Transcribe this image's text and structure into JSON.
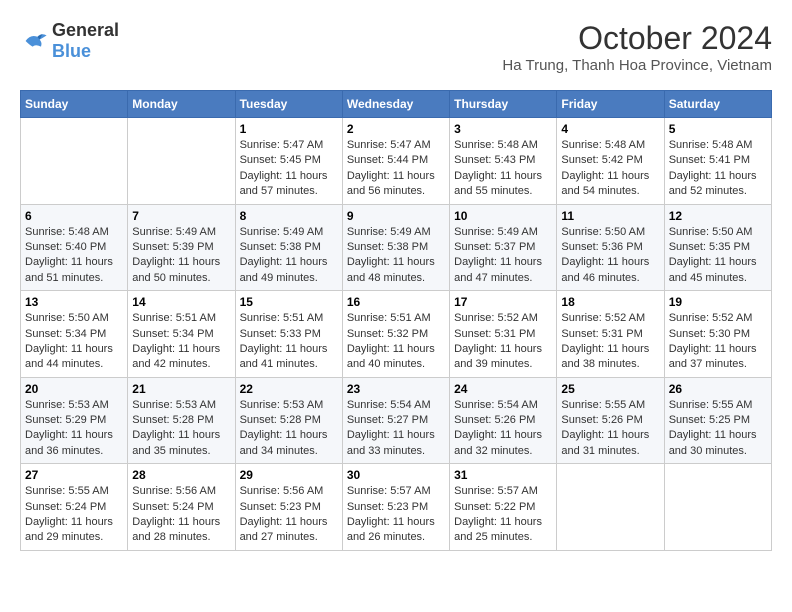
{
  "logo": {
    "line1": "General",
    "line2": "Blue"
  },
  "title": "October 2024",
  "location": "Ha Trung, Thanh Hoa Province, Vietnam",
  "headers": [
    "Sunday",
    "Monday",
    "Tuesday",
    "Wednesday",
    "Thursday",
    "Friday",
    "Saturday"
  ],
  "weeks": [
    [
      {
        "day": "",
        "sunrise": "",
        "sunset": "",
        "daylight": ""
      },
      {
        "day": "",
        "sunrise": "",
        "sunset": "",
        "daylight": ""
      },
      {
        "day": "1",
        "sunrise": "Sunrise: 5:47 AM",
        "sunset": "Sunset: 5:45 PM",
        "daylight": "Daylight: 11 hours and 57 minutes."
      },
      {
        "day": "2",
        "sunrise": "Sunrise: 5:47 AM",
        "sunset": "Sunset: 5:44 PM",
        "daylight": "Daylight: 11 hours and 56 minutes."
      },
      {
        "day": "3",
        "sunrise": "Sunrise: 5:48 AM",
        "sunset": "Sunset: 5:43 PM",
        "daylight": "Daylight: 11 hours and 55 minutes."
      },
      {
        "day": "4",
        "sunrise": "Sunrise: 5:48 AM",
        "sunset": "Sunset: 5:42 PM",
        "daylight": "Daylight: 11 hours and 54 minutes."
      },
      {
        "day": "5",
        "sunrise": "Sunrise: 5:48 AM",
        "sunset": "Sunset: 5:41 PM",
        "daylight": "Daylight: 11 hours and 52 minutes."
      }
    ],
    [
      {
        "day": "6",
        "sunrise": "Sunrise: 5:48 AM",
        "sunset": "Sunset: 5:40 PM",
        "daylight": "Daylight: 11 hours and 51 minutes."
      },
      {
        "day": "7",
        "sunrise": "Sunrise: 5:49 AM",
        "sunset": "Sunset: 5:39 PM",
        "daylight": "Daylight: 11 hours and 50 minutes."
      },
      {
        "day": "8",
        "sunrise": "Sunrise: 5:49 AM",
        "sunset": "Sunset: 5:38 PM",
        "daylight": "Daylight: 11 hours and 49 minutes."
      },
      {
        "day": "9",
        "sunrise": "Sunrise: 5:49 AM",
        "sunset": "Sunset: 5:38 PM",
        "daylight": "Daylight: 11 hours and 48 minutes."
      },
      {
        "day": "10",
        "sunrise": "Sunrise: 5:49 AM",
        "sunset": "Sunset: 5:37 PM",
        "daylight": "Daylight: 11 hours and 47 minutes."
      },
      {
        "day": "11",
        "sunrise": "Sunrise: 5:50 AM",
        "sunset": "Sunset: 5:36 PM",
        "daylight": "Daylight: 11 hours and 46 minutes."
      },
      {
        "day": "12",
        "sunrise": "Sunrise: 5:50 AM",
        "sunset": "Sunset: 5:35 PM",
        "daylight": "Daylight: 11 hours and 45 minutes."
      }
    ],
    [
      {
        "day": "13",
        "sunrise": "Sunrise: 5:50 AM",
        "sunset": "Sunset: 5:34 PM",
        "daylight": "Daylight: 11 hours and 44 minutes."
      },
      {
        "day": "14",
        "sunrise": "Sunrise: 5:51 AM",
        "sunset": "Sunset: 5:34 PM",
        "daylight": "Daylight: 11 hours and 42 minutes."
      },
      {
        "day": "15",
        "sunrise": "Sunrise: 5:51 AM",
        "sunset": "Sunset: 5:33 PM",
        "daylight": "Daylight: 11 hours and 41 minutes."
      },
      {
        "day": "16",
        "sunrise": "Sunrise: 5:51 AM",
        "sunset": "Sunset: 5:32 PM",
        "daylight": "Daylight: 11 hours and 40 minutes."
      },
      {
        "day": "17",
        "sunrise": "Sunrise: 5:52 AM",
        "sunset": "Sunset: 5:31 PM",
        "daylight": "Daylight: 11 hours and 39 minutes."
      },
      {
        "day": "18",
        "sunrise": "Sunrise: 5:52 AM",
        "sunset": "Sunset: 5:31 PM",
        "daylight": "Daylight: 11 hours and 38 minutes."
      },
      {
        "day": "19",
        "sunrise": "Sunrise: 5:52 AM",
        "sunset": "Sunset: 5:30 PM",
        "daylight": "Daylight: 11 hours and 37 minutes."
      }
    ],
    [
      {
        "day": "20",
        "sunrise": "Sunrise: 5:53 AM",
        "sunset": "Sunset: 5:29 PM",
        "daylight": "Daylight: 11 hours and 36 minutes."
      },
      {
        "day": "21",
        "sunrise": "Sunrise: 5:53 AM",
        "sunset": "Sunset: 5:28 PM",
        "daylight": "Daylight: 11 hours and 35 minutes."
      },
      {
        "day": "22",
        "sunrise": "Sunrise: 5:53 AM",
        "sunset": "Sunset: 5:28 PM",
        "daylight": "Daylight: 11 hours and 34 minutes."
      },
      {
        "day": "23",
        "sunrise": "Sunrise: 5:54 AM",
        "sunset": "Sunset: 5:27 PM",
        "daylight": "Daylight: 11 hours and 33 minutes."
      },
      {
        "day": "24",
        "sunrise": "Sunrise: 5:54 AM",
        "sunset": "Sunset: 5:26 PM",
        "daylight": "Daylight: 11 hours and 32 minutes."
      },
      {
        "day": "25",
        "sunrise": "Sunrise: 5:55 AM",
        "sunset": "Sunset: 5:26 PM",
        "daylight": "Daylight: 11 hours and 31 minutes."
      },
      {
        "day": "26",
        "sunrise": "Sunrise: 5:55 AM",
        "sunset": "Sunset: 5:25 PM",
        "daylight": "Daylight: 11 hours and 30 minutes."
      }
    ],
    [
      {
        "day": "27",
        "sunrise": "Sunrise: 5:55 AM",
        "sunset": "Sunset: 5:24 PM",
        "daylight": "Daylight: 11 hours and 29 minutes."
      },
      {
        "day": "28",
        "sunrise": "Sunrise: 5:56 AM",
        "sunset": "Sunset: 5:24 PM",
        "daylight": "Daylight: 11 hours and 28 minutes."
      },
      {
        "day": "29",
        "sunrise": "Sunrise: 5:56 AM",
        "sunset": "Sunset: 5:23 PM",
        "daylight": "Daylight: 11 hours and 27 minutes."
      },
      {
        "day": "30",
        "sunrise": "Sunrise: 5:57 AM",
        "sunset": "Sunset: 5:23 PM",
        "daylight": "Daylight: 11 hours and 26 minutes."
      },
      {
        "day": "31",
        "sunrise": "Sunrise: 5:57 AM",
        "sunset": "Sunset: 5:22 PM",
        "daylight": "Daylight: 11 hours and 25 minutes."
      },
      {
        "day": "",
        "sunrise": "",
        "sunset": "",
        "daylight": ""
      },
      {
        "day": "",
        "sunrise": "",
        "sunset": "",
        "daylight": ""
      }
    ]
  ]
}
